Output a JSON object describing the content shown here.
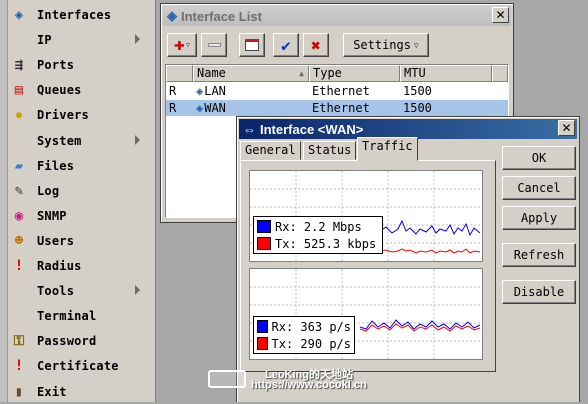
{
  "menu": {
    "items": [
      {
        "label": "Interfaces",
        "icon": "interfaces-icon",
        "submenu": false
      },
      {
        "label": "IP",
        "icon": "",
        "submenu": true
      },
      {
        "label": "Ports",
        "icon": "ports-icon",
        "submenu": false
      },
      {
        "label": "Queues",
        "icon": "queues-icon",
        "submenu": false
      },
      {
        "label": "Drivers",
        "icon": "drivers-icon",
        "submenu": false
      },
      {
        "label": "System",
        "icon": "",
        "submenu": true
      },
      {
        "label": "Files",
        "icon": "files-icon",
        "submenu": false
      },
      {
        "label": "Log",
        "icon": "log-icon",
        "submenu": false
      },
      {
        "label": "SNMP",
        "icon": "snmp-icon",
        "submenu": false
      },
      {
        "label": "Users",
        "icon": "users-icon",
        "submenu": false
      },
      {
        "label": "Radius",
        "icon": "radius-icon",
        "submenu": false
      },
      {
        "label": "Tools",
        "icon": "",
        "submenu": true
      },
      {
        "label": "Terminal",
        "icon": "",
        "submenu": false
      },
      {
        "label": "Password",
        "icon": "password-icon",
        "submenu": false
      },
      {
        "label": "Certificate",
        "icon": "certificate-icon",
        "submenu": false
      },
      {
        "label": "Exit",
        "icon": "exit-icon",
        "submenu": false
      }
    ]
  },
  "iflist": {
    "title": "Interface List",
    "settings_label": "Settings",
    "columns": [
      "Name",
      "Type",
      "MTU"
    ],
    "rows": [
      {
        "flag": "R",
        "name": "LAN",
        "type": "Ethernet",
        "mtu": "1500",
        "selected": false
      },
      {
        "flag": "R",
        "name": "WAN",
        "type": "Ethernet",
        "mtu": "1500",
        "selected": true
      }
    ]
  },
  "ifwan": {
    "title": "Interface <WAN>",
    "tabs": [
      "General",
      "Status",
      "Traffic"
    ],
    "active_tab": "Traffic",
    "buttons": [
      "OK",
      "Cancel",
      "Apply",
      "Refresh",
      "Disable"
    ],
    "legend_top": [
      {
        "label": "Rx:",
        "value": "2.2 Mbps",
        "color": "#0000ff"
      },
      {
        "label": "Tx:",
        "value": "525.3 kbps",
        "color": "#ff0000"
      }
    ],
    "legend_bottom": [
      {
        "label": "Rx:",
        "value": "363 p/s",
        "color": "#0000ff"
      },
      {
        "label": "Tx:",
        "value": "290 p/s",
        "color": "#ff0000"
      }
    ]
  },
  "watermark": {
    "line1": "LeoKing的天地站",
    "line2": "https://www.cocokl.cn"
  }
}
